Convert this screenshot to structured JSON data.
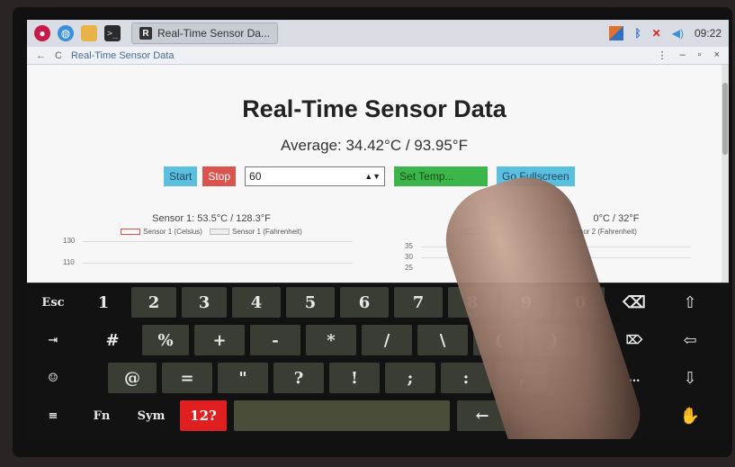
{
  "taskbar": {
    "window_title": "Real-Time Sensor Da...",
    "window_icon_letter": "R",
    "clock": "09:22",
    "icons": [
      "raspberry-pi-menu-icon",
      "web-browser-icon",
      "file-manager-icon",
      "terminal-icon"
    ],
    "tray_icons": [
      "task-manager-icon",
      "bluetooth-icon",
      "network-icon",
      "volume-icon"
    ]
  },
  "browser": {
    "back_icon": "←",
    "reload_icon": "C",
    "address": "Real-Time Sensor Data",
    "window_controls": [
      "⋮",
      "–",
      "▫",
      "×"
    ]
  },
  "page": {
    "title": "Real-Time Sensor Data",
    "average": "Average: 34.42°C / 93.95°F",
    "start_label": "Start",
    "stop_label": "Stop",
    "interval_value": "60",
    "set_temp_label": "Set Temp...",
    "fullscreen_label": "Go Fullscreen"
  },
  "charts": [
    {
      "title": "Sensor 1: 53.5°C / 128.3°F",
      "legend": [
        "Sensor 1 (Celsius)",
        "Sensor 1 (Fahrenheit)"
      ],
      "yticks": [
        "130",
        "110"
      ],
      "colors": [
        "#d9534f",
        "#bbbbbb"
      ]
    },
    {
      "title": "0°C / 32°F",
      "legend": [
        "",
        "Sensor 2 (Fahrenheit)"
      ],
      "yticks": [
        "35",
        "30",
        "25"
      ],
      "colors": [
        "#5bc0de",
        "#bbbbbb"
      ]
    }
  ],
  "keyboard": {
    "row1": [
      "Esc",
      "1",
      "2",
      "3",
      "4",
      "5",
      "6",
      "7",
      "8",
      "9",
      "0",
      "⌫",
      "⇧"
    ],
    "row2": [
      "⇥",
      "#",
      "%",
      "+",
      "-",
      "*",
      "/",
      "\\",
      "(",
      ")",
      "=",
      "⌦",
      "⇦"
    ],
    "row3": [
      "☺",
      "@",
      "=",
      "\"",
      "?",
      "!",
      ";",
      ":",
      ",",
      ".",
      "…",
      "⇩"
    ],
    "row4": [
      "≡",
      "Fn",
      "Sym",
      "12?",
      "",
      "←",
      "→",
      "✋"
    ]
  },
  "colors": {
    "start": "#5bc0de",
    "stop": "#d9534f",
    "set_temp": "#3cb54a",
    "keyboard_bg": "#121212",
    "active_key": "#e02020"
  }
}
